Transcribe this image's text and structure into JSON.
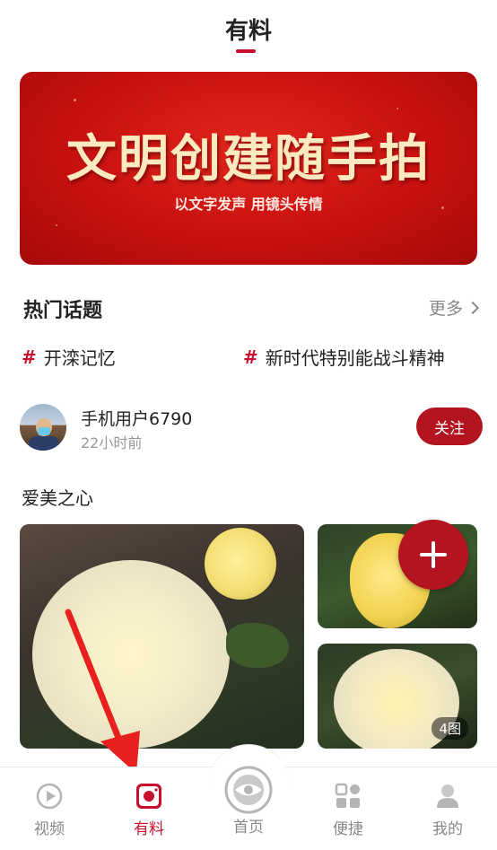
{
  "header": {
    "title": "有料"
  },
  "banner": {
    "title": "文明创建随手拍",
    "subtitle": "以文字发声 用镜头传情"
  },
  "hot_topics": {
    "title": "热门话题",
    "more_label": "更多",
    "items": [
      {
        "hash": "#",
        "label": "开滦记忆"
      },
      {
        "hash": "#",
        "label": "新时代特别能战斗精神"
      }
    ]
  },
  "post": {
    "username": "手机用户6790",
    "time": "22小时前",
    "follow_label": "关注",
    "text": "爱美之心",
    "image_count": "4图"
  },
  "tabbar": {
    "items": [
      {
        "label": "视频",
        "icon": "play-icon"
      },
      {
        "label": "有料",
        "icon": "camera-icon"
      },
      {
        "label": "首页",
        "icon": "home-logo-icon"
      },
      {
        "label": "便捷",
        "icon": "grid-icon"
      },
      {
        "label": "我的",
        "icon": "user-icon"
      }
    ],
    "active": "有料"
  },
  "colors": {
    "accent": "#c8102e",
    "follow_button": "#b3141f",
    "muted_text": "#888888"
  }
}
